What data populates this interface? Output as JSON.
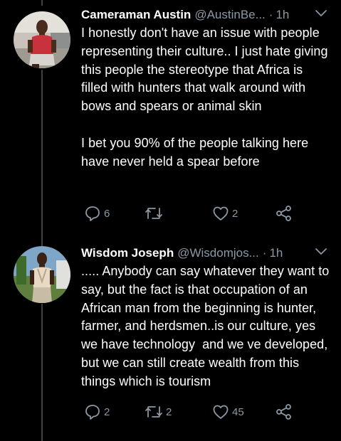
{
  "theme": {
    "background": "#000000",
    "text": "#ffffff",
    "secondary_text": "#8b98a5",
    "thread_line": "#3d4044"
  },
  "tweets": [
    {
      "display_name": "Cameraman Austin",
      "handle": "@AustinBe...",
      "separator": "·",
      "time": "1h",
      "text": "I honestly don't have an issue with people representing their culture.. I just hate giving this people the stereotype that Africa is filled with hunters that walk around with bows and spears or animal skin\n\nI bet you 90% of the people talking here have never held a spear before",
      "replies": "6",
      "retweets": "",
      "likes": "2",
      "icons": [
        "reply-icon",
        "retweet-icon",
        "like-icon",
        "share-icon"
      ]
    },
    {
      "display_name": "Wisdom Joseph",
      "handle": "@Wisdomjos...",
      "separator": "·",
      "time": "1h",
      "text": "..... Anybody can say whatever they want to say, but the fact is that occupation of an African man from the beginning is hunter, farmer, and herdsmen..is our culture, yes we have technology  and we ve developed, but we can still create wealth from this things which is tourism",
      "replies": "2",
      "retweets": "2",
      "likes": "45",
      "icons": [
        "reply-icon",
        "retweet-icon",
        "like-icon",
        "share-icon"
      ]
    }
  ]
}
